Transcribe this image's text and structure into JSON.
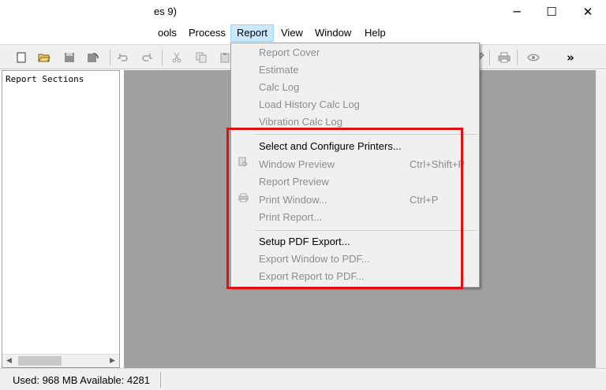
{
  "window": {
    "title": "es 9)",
    "minimize_glyph": "─",
    "maximize_glyph": "☐",
    "close_glyph": "✕"
  },
  "menubar": {
    "items": [
      {
        "label": "ools"
      },
      {
        "label": "Process"
      },
      {
        "label": "Report"
      },
      {
        "label": "View"
      },
      {
        "label": "Window"
      },
      {
        "label": "Help"
      }
    ]
  },
  "toolbar": {
    "overflow_glyph": "»"
  },
  "left_panel": {
    "title": "Report Sections"
  },
  "status": {
    "text": "Used: 968 MB  Available: 4281"
  },
  "report_menu": {
    "items": [
      {
        "label": "Report Cover",
        "enabled": false
      },
      {
        "label": "Estimate",
        "enabled": false
      },
      {
        "label": "Calc Log",
        "enabled": false
      },
      {
        "label": "Load History Calc Log",
        "enabled": false
      },
      {
        "label": "Vibration Calc Log",
        "enabled": false
      },
      {
        "label": "Select and Configure Printers...",
        "enabled": true
      },
      {
        "label": "Window Preview",
        "shortcut": "Ctrl+Shift+P",
        "enabled": false,
        "icon": "preview-icon"
      },
      {
        "label": "Report Preview",
        "enabled": false
      },
      {
        "label": "Print Window...",
        "shortcut": "Ctrl+P",
        "enabled": false,
        "icon": "printer-icon"
      },
      {
        "label": "Print Report...",
        "enabled": false
      },
      {
        "label": "Setup PDF Export...",
        "enabled": true
      },
      {
        "label": "Export Window to PDF...",
        "enabled": false
      },
      {
        "label": "Export Report to PDF...",
        "enabled": false
      }
    ]
  },
  "colors": {
    "highlight_box": "#e01010",
    "menu_active_bg": "#cce8ff",
    "disabled_text": "#8d8d8d",
    "workspace_bg": "#a0a0a0"
  }
}
